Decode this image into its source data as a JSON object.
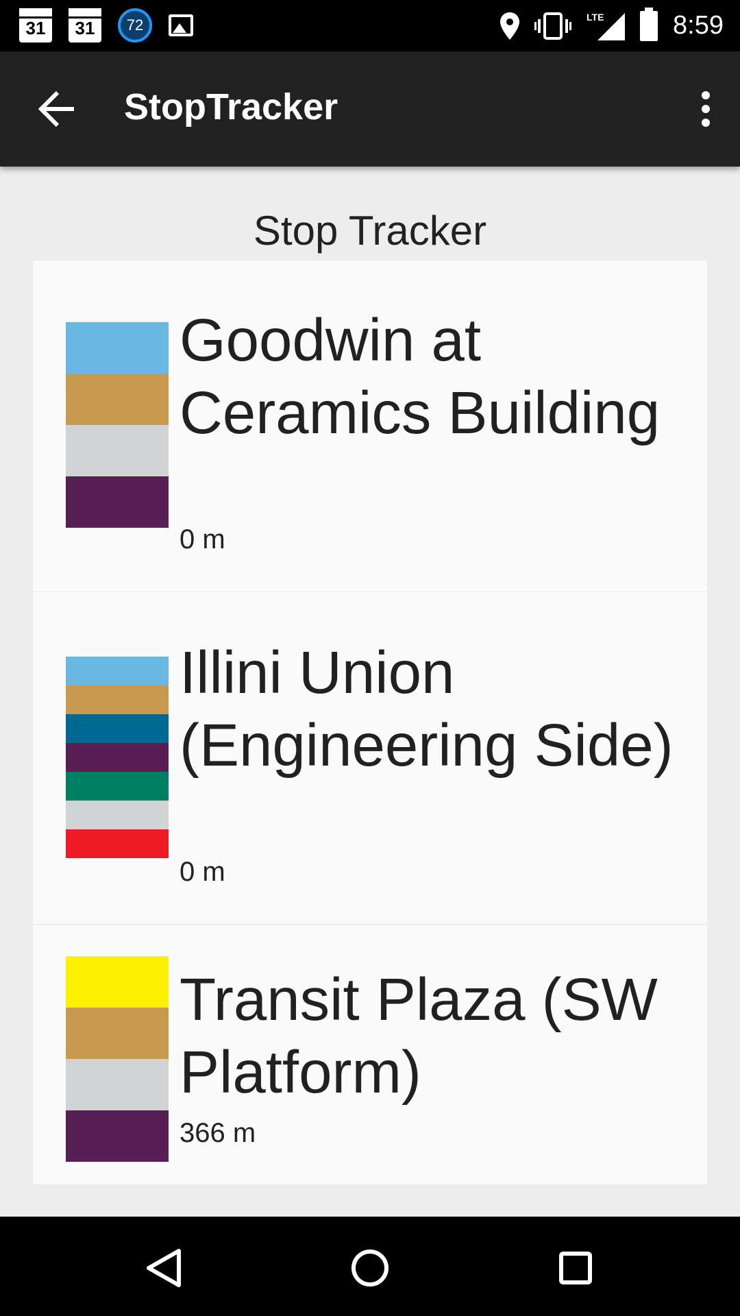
{
  "status_bar": {
    "calendar_day_1": "31",
    "calendar_day_2": "31",
    "data_usage_badge": "72",
    "network_label": "LTE",
    "time": "8:59"
  },
  "app_bar": {
    "title": "StopTracker",
    "back_icon": "arrow-back-icon",
    "overflow_icon": "more-vert-icon"
  },
  "content": {
    "heading": "Stop Tracker",
    "stops": [
      {
        "name": "Goodwin at Ceramics Building",
        "distance": "0 m",
        "route_colors": [
          "#6bb7e4",
          "#c89a4e",
          "#d2d3d4",
          "#581f55"
        ]
      },
      {
        "name": "Illini Union (Engineering Side)",
        "distance": "0 m",
        "route_colors": [
          "#6bb7e4",
          "#c89a4e",
          "#006991",
          "#581f55",
          "#008063",
          "#d2d3d4",
          "#ed1c24"
        ]
      },
      {
        "name": "Transit Plaza (SW Platform)",
        "distance": "366 m",
        "route_colors": [
          "#fff200",
          "#c89a4e",
          "#d2d3d4",
          "#581f55"
        ]
      }
    ]
  },
  "nav_bar": {
    "back_icon": "nav-back-icon",
    "home_icon": "nav-home-icon",
    "recents_icon": "nav-recents-icon"
  }
}
